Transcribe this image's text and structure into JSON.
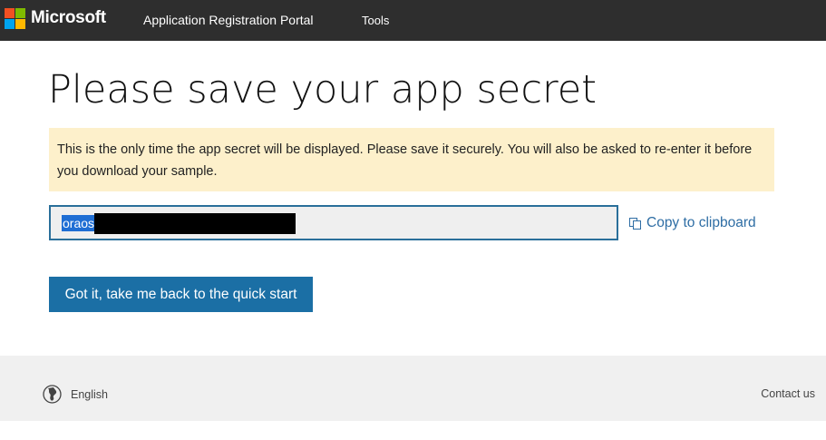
{
  "header": {
    "brand": "Microsoft",
    "logo_colors": [
      "#f25022",
      "#7fba00",
      "#00a4ef",
      "#ffb900"
    ],
    "nav": {
      "portal": "Application Registration Portal",
      "tools": "Tools"
    }
  },
  "main": {
    "title": "Please save your app secret",
    "warning": "This is the only time the app secret will be displayed. Please save it securely. You will also be asked to re-enter it before you download your sample.",
    "secret_value_visible": "oraos",
    "copy_label": "Copy to clipboard",
    "button_label": "Got it, take me back to the quick start"
  },
  "footer": {
    "language": "English",
    "contact": "Contact us"
  },
  "colors": {
    "topbar": "#2e2e2e",
    "warning_bg": "#fdf0cb",
    "primary": "#1b6fa5",
    "link": "#2e6da4"
  }
}
